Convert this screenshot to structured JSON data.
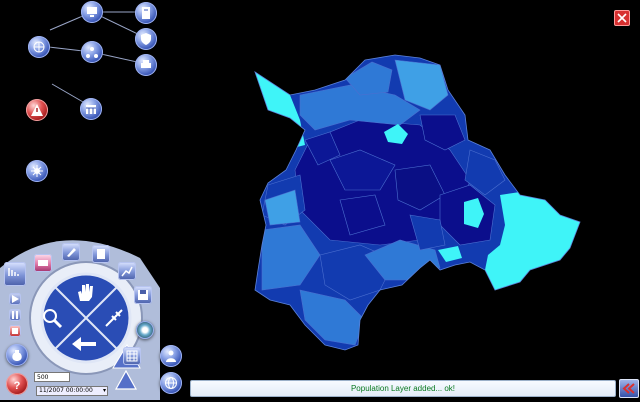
{
  "status": {
    "message": "Population Layer added... ok!"
  },
  "controls": {
    "scale_value": "500",
    "date_value": "11/2007 00:00:00"
  },
  "colors": {
    "background": "#000000",
    "map_dark": "#0b0e8c",
    "map_mid": "#123bb0",
    "map_light": "#2f79d6",
    "map_lightest": "#3fa0e6",
    "map_cyan": "#3ff4f8",
    "status_text": "#0a7a20",
    "close_button": "#d83030"
  },
  "icons": {
    "top_toolbar": [
      "computer-icon",
      "storage-icon",
      "globe-icon",
      "network-icon",
      "shield-icon",
      "printer-icon",
      "warning-icon",
      "calendar-icon",
      "settings-icon"
    ],
    "wheel": [
      "hand-pan-icon",
      "zoom-icon",
      "measure-icon",
      "back-arrow-icon"
    ]
  }
}
